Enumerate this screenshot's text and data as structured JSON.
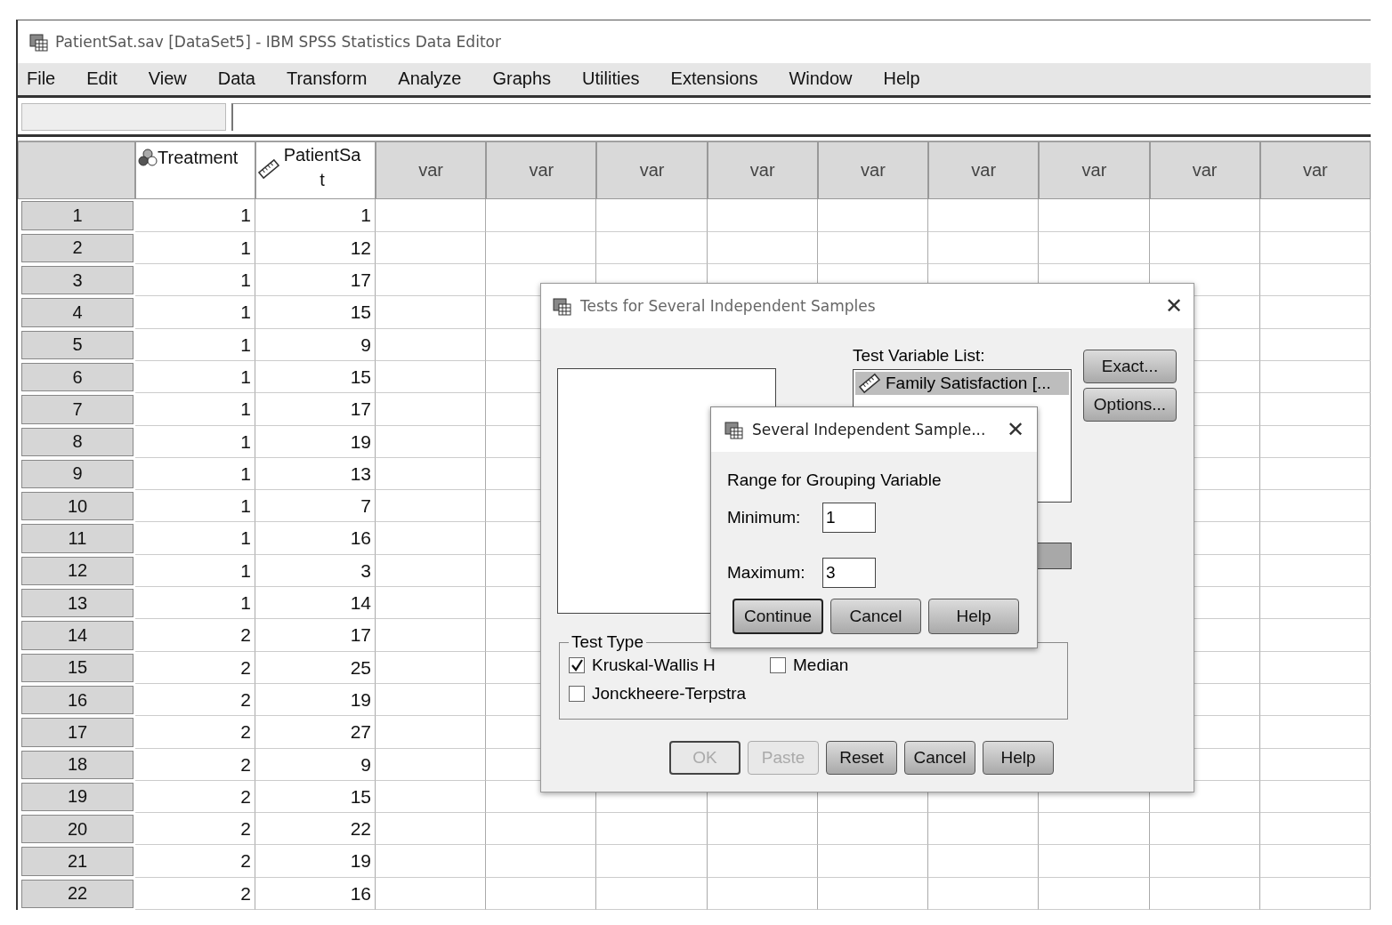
{
  "window": {
    "title": "PatientSat.sav [DataSet5] - IBM SPSS Statistics Data Editor"
  },
  "menu": [
    {
      "label": "File"
    },
    {
      "label": "Edit"
    },
    {
      "label": "View"
    },
    {
      "label": "Data"
    },
    {
      "label": "Transform"
    },
    {
      "label": "Analyze"
    },
    {
      "label": "Graphs"
    },
    {
      "label": "Utilities"
    },
    {
      "label": "Extensions"
    },
    {
      "label": "Window"
    },
    {
      "label": "Help"
    }
  ],
  "table": {
    "columns": [
      {
        "label": "Treatment",
        "kind": "nominal"
      },
      {
        "label": "PatientSa t",
        "kind": "scale"
      },
      {
        "label": "var",
        "kind": "empty"
      },
      {
        "label": "var",
        "kind": "empty"
      },
      {
        "label": "var",
        "kind": "empty"
      },
      {
        "label": "var",
        "kind": "empty"
      },
      {
        "label": "var",
        "kind": "empty"
      },
      {
        "label": "var",
        "kind": "empty"
      },
      {
        "label": "var",
        "kind": "empty"
      },
      {
        "label": "var",
        "kind": "empty"
      },
      {
        "label": "var",
        "kind": "empty"
      }
    ],
    "rows": [
      {
        "n": "1",
        "cells": [
          "1",
          "1"
        ]
      },
      {
        "n": "2",
        "cells": [
          "1",
          "12"
        ]
      },
      {
        "n": "3",
        "cells": [
          "1",
          "17"
        ]
      },
      {
        "n": "4",
        "cells": [
          "1",
          "15"
        ]
      },
      {
        "n": "5",
        "cells": [
          "1",
          "9"
        ]
      },
      {
        "n": "6",
        "cells": [
          "1",
          "15"
        ]
      },
      {
        "n": "7",
        "cells": [
          "1",
          "17"
        ]
      },
      {
        "n": "8",
        "cells": [
          "1",
          "19"
        ]
      },
      {
        "n": "9",
        "cells": [
          "1",
          "13"
        ]
      },
      {
        "n": "10",
        "cells": [
          "1",
          "7"
        ]
      },
      {
        "n": "11",
        "cells": [
          "1",
          "16"
        ]
      },
      {
        "n": "12",
        "cells": [
          "1",
          "3"
        ]
      },
      {
        "n": "13",
        "cells": [
          "1",
          "14"
        ]
      },
      {
        "n": "14",
        "cells": [
          "2",
          "17"
        ]
      },
      {
        "n": "15",
        "cells": [
          "2",
          "25"
        ]
      },
      {
        "n": "16",
        "cells": [
          "2",
          "19"
        ]
      },
      {
        "n": "17",
        "cells": [
          "2",
          "27"
        ]
      },
      {
        "n": "18",
        "cells": [
          "2",
          "9"
        ]
      },
      {
        "n": "19",
        "cells": [
          "2",
          "15"
        ]
      },
      {
        "n": "20",
        "cells": [
          "2",
          "22"
        ]
      },
      {
        "n": "21",
        "cells": [
          "2",
          "19"
        ]
      },
      {
        "n": "22",
        "cells": [
          "2",
          "16"
        ]
      }
    ]
  },
  "dialog": {
    "title": "Tests for Several Independent Samples",
    "close": "✕",
    "test_variable_label": {
      "label": "Test Variable List:"
    },
    "test_variables": [
      {
        "label": "Family Satisfaction [...",
        "selected": true
      }
    ],
    "side_buttons": [
      {
        "label": "Exact..."
      },
      {
        "label": "Options..."
      }
    ],
    "test_type": {
      "title": "Test Type",
      "options": [
        {
          "label": "Kruskal-Wallis H",
          "checked": true
        },
        {
          "label": "Median",
          "checked": false
        },
        {
          "label": "Jonckheere-Terpstra",
          "checked": false
        }
      ]
    },
    "buttons": [
      {
        "label": "OK",
        "disabled": true,
        "default": true
      },
      {
        "label": "Paste",
        "disabled": true,
        "default": false
      },
      {
        "label": "Reset",
        "disabled": false,
        "default": false
      },
      {
        "label": "Cancel",
        "disabled": false,
        "default": false
      },
      {
        "label": "Help",
        "disabled": false,
        "default": false
      }
    ]
  },
  "subdialog": {
    "title": "Several Independent Sample...",
    "close": "✕",
    "heading": "Range for Grouping Variable",
    "fields": [
      {
        "label": "Minimum:",
        "value": "1"
      },
      {
        "label": "Maximum:",
        "value": "3"
      }
    ],
    "buttons": [
      {
        "label": "Continue",
        "default": true
      },
      {
        "label": "Cancel",
        "default": false
      },
      {
        "label": "Help",
        "default": false
      }
    ]
  }
}
